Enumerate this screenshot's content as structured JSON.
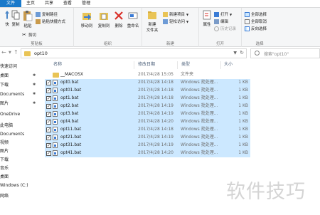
{
  "tabs": [
    "文件",
    "主页",
    "共享",
    "查看",
    "管理"
  ],
  "ribbon": {
    "clipboard": {
      "pin_label": "快",
      "copy_label": "复制",
      "paste_label": "粘贴",
      "copy_path_label": "复制路径",
      "paste_shortcut_label": "粘贴快捷方式",
      "cut_label": "剪切",
      "group_label": "剪贴板"
    },
    "organize": {
      "move_to_label": "移动到",
      "copy_to_label": "复制到",
      "delete_label": "删除",
      "rename_label": "重命名",
      "group_label": "组织"
    },
    "new": {
      "new_folder_label": "新建\n文件夹",
      "new_item_label": "新建项目",
      "easy_access_label": "轻松访问",
      "group_label": "新建"
    },
    "open": {
      "properties_label": "属性",
      "open_label": "打开",
      "edit_label": "编辑",
      "history_label": "历史记录",
      "group_label": "打开"
    },
    "select": {
      "select_all_label": "全部选择",
      "select_none_label": "全部取消",
      "invert_label": "反向选择",
      "group_label": "选择"
    }
  },
  "address": {
    "crumb": "opt10",
    "search_placeholder": "搜索\"opt10\""
  },
  "nav": {
    "items": [
      {
        "label": "快速访问",
        "pinned": false
      },
      {
        "label": "桌面",
        "pinned": true
      },
      {
        "label": "下载",
        "pinned": true
      },
      {
        "label": "Documents",
        "pinned": true
      },
      {
        "label": "图片",
        "pinned": true
      },
      {
        "label": "OneDrive",
        "pinned": false
      },
      {
        "label": "此电脑",
        "pinned": false
      },
      {
        "label": "Documents",
        "pinned": false
      },
      {
        "label": "视频",
        "pinned": false
      },
      {
        "label": "图片",
        "pinned": false
      },
      {
        "label": "下载",
        "pinned": false
      },
      {
        "label": "音乐",
        "pinned": false
      },
      {
        "label": "桌面",
        "pinned": false
      },
      {
        "label": "Windows (C:)",
        "pinned": false
      },
      {
        "label": "网络",
        "pinned": false
      }
    ],
    "pin_glyph": "✱"
  },
  "columns": {
    "name": "名称",
    "date": "修改日期",
    "type": "类型",
    "size": "大小"
  },
  "files": [
    {
      "name": "__MACOSX",
      "date": "2017/4/28 15:05",
      "type": "文件夹",
      "size": "",
      "selected": false,
      "kind": "folder"
    },
    {
      "name": "opt0.bat",
      "date": "2017/4/28 14:18",
      "type": "Windows 批处理...",
      "size": "1 KB",
      "selected": true,
      "kind": "bat"
    },
    {
      "name": "opt01.bat",
      "date": "2017/4/28 14:18",
      "type": "Windows 批处理...",
      "size": "1 KB",
      "selected": true,
      "kind": "bat"
    },
    {
      "name": "opt1.bat",
      "date": "2017/4/28 14:18",
      "type": "Windows 批处理...",
      "size": "1 KB",
      "selected": true,
      "kind": "bat"
    },
    {
      "name": "opt2.bat",
      "date": "2017/4/28 14:19",
      "type": "Windows 批处理...",
      "size": "1 KB",
      "selected": true,
      "kind": "bat"
    },
    {
      "name": "opt3.bat",
      "date": "2017/4/28 14:19",
      "type": "Windows 批处理...",
      "size": "1 KB",
      "selected": true,
      "kind": "bat"
    },
    {
      "name": "opt4.bat",
      "date": "2017/4/28 14:20",
      "type": "Windows 批处理...",
      "size": "1 KB",
      "selected": true,
      "kind": "bat"
    },
    {
      "name": "opt11.bat",
      "date": "2017/4/28 14:18",
      "type": "Windows 批处理...",
      "size": "1 KB",
      "selected": true,
      "kind": "bat"
    },
    {
      "name": "opt21.bat",
      "date": "2017/4/28 14:19",
      "type": "Windows 批处理...",
      "size": "1 KB",
      "selected": true,
      "kind": "bat"
    },
    {
      "name": "opt31.bat",
      "date": "2017/4/28 14:19",
      "type": "Windows 批处理...",
      "size": "1 KB",
      "selected": true,
      "kind": "bat"
    },
    {
      "name": "opt41.bat",
      "date": "2017/4/28 14:20",
      "type": "Windows 批处理...",
      "size": "1 KB",
      "selected": true,
      "kind": "bat"
    }
  ],
  "checkbox_glyph": "✓",
  "watermark": "软件技巧",
  "colors": {
    "file_tab": "#1979ca",
    "selection": "#cce8ff",
    "folder": "#e9c456",
    "delete_red": "#d9302a"
  }
}
